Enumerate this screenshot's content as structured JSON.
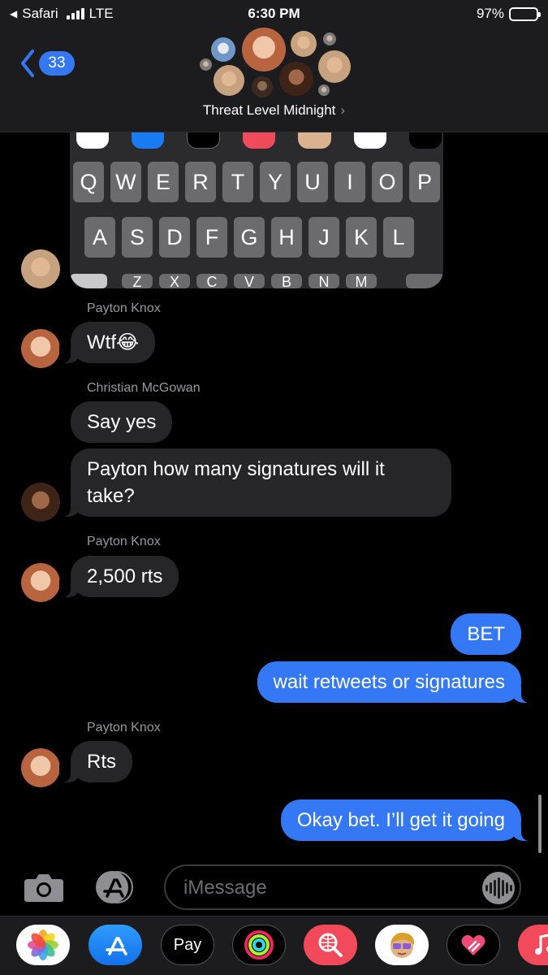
{
  "status_bar": {
    "back_app": "Safari",
    "network": "LTE",
    "time": "6:30 PM",
    "battery": "97%"
  },
  "header": {
    "back_count": "33",
    "group_name": "Threat Level Midnight",
    "group_chevron": "›"
  },
  "keyboard_image": {
    "row1": [
      "Q",
      "W",
      "E",
      "R",
      "T",
      "Y",
      "U",
      "I",
      "O",
      "P"
    ],
    "row2": [
      "A",
      "S",
      "D",
      "F",
      "G",
      "H",
      "J",
      "K",
      "L"
    ],
    "row3": [
      "Z",
      "X",
      "C",
      "V",
      "B",
      "N",
      "M"
    ],
    "applepay_label": "Pay"
  },
  "messages": [
    {
      "sender": "Payton Knox",
      "text": "Wtf😂"
    },
    {
      "sender": "Christian McGowan",
      "text": "Say yes"
    },
    {
      "text": "Payton how many signatures will it take?"
    },
    {
      "sender": "Payton Knox",
      "text": "2,500 rts"
    },
    {
      "text": "BET"
    },
    {
      "text": "wait retweets or signatures"
    },
    {
      "sender": "Payton Knox",
      "text": "Rts"
    },
    {
      "text": "Okay bet. I’ll get it going"
    }
  ],
  "input": {
    "placeholder": "iMessage"
  },
  "drawer": {
    "apps": [
      "photos-icon",
      "app-store-icon",
      "apple-pay-icon",
      "activity-icon",
      "search-images-icon",
      "memoji-icon",
      "digital-touch-icon",
      "music-icon"
    ],
    "applepay_label": "Pay"
  },
  "colors": {
    "background": "#000000",
    "header": "#1c1c1e",
    "incoming_bubble": "#262628",
    "outgoing_bubble": "#3478f6",
    "sender_name": "#98989f"
  }
}
